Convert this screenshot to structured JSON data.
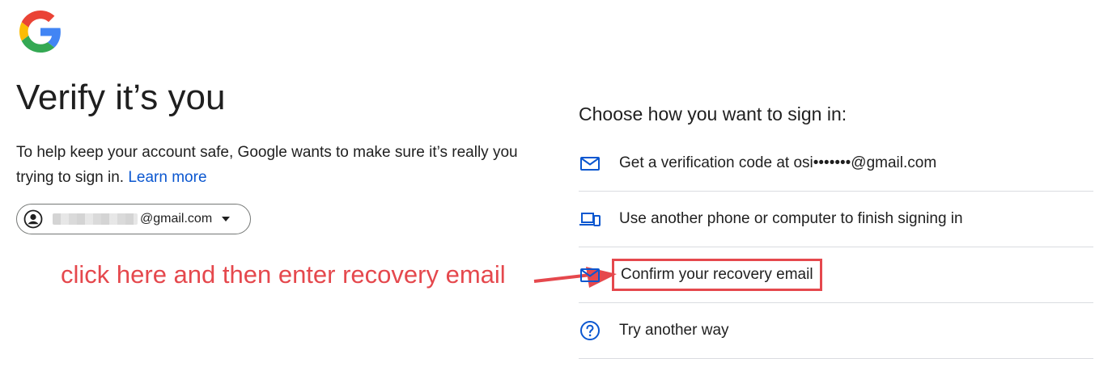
{
  "logo": {
    "icon": "google-g-logo"
  },
  "title": "Verify it’s you",
  "description": {
    "text": "To help keep your account safe, Google wants to make sure it’s really you trying to sign in.",
    "link": "Learn more"
  },
  "account": {
    "email_suffix": "@gmail.com",
    "icon": "account-circle-icon"
  },
  "annotation": {
    "text": "click here and then enter recovery email",
    "color": "#e5484d"
  },
  "choose": {
    "heading": "Choose how you want to sign in:",
    "options": [
      {
        "label": "Get a verification code at osi•••••••@gmail.com",
        "icon": "mail-icon"
      },
      {
        "label": "Use another phone or computer to finish signing in",
        "icon": "devices-icon"
      },
      {
        "label": "Confirm your recovery email",
        "icon": "mail-icon",
        "highlighted": true
      },
      {
        "label": "Try another way",
        "icon": "help-circle-icon"
      }
    ]
  },
  "colors": {
    "accent": "#0b57d0",
    "text": "#1f1f1f",
    "divider": "#dadce0",
    "annotation": "#e5484d"
  }
}
